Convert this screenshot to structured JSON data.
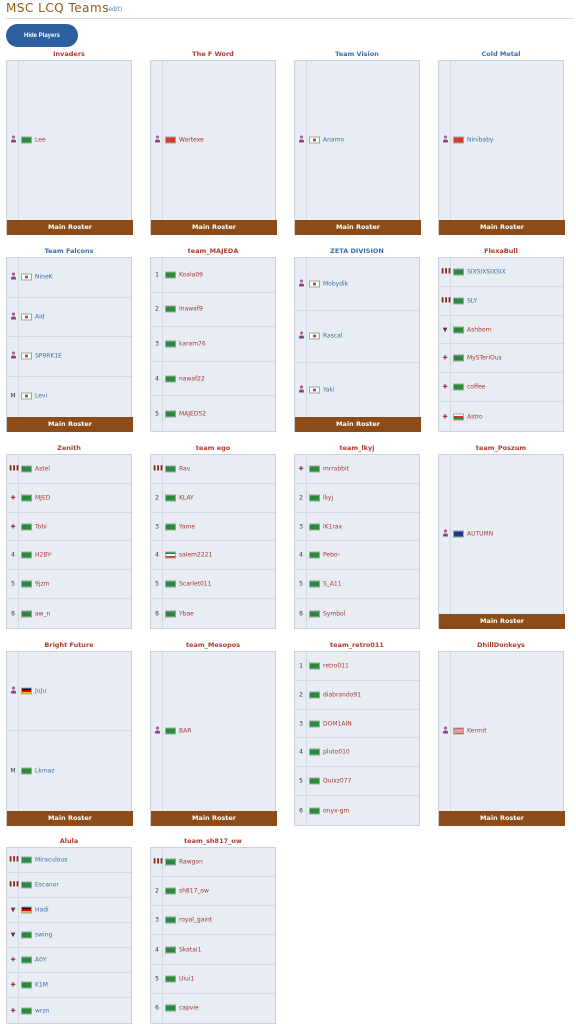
{
  "header": {
    "title": "MSC LCQ Teams",
    "edit": "(edit)"
  },
  "hide_button": "Hide Players",
  "roster_label": "Main Roster",
  "teams": [
    {
      "name": "Invaders",
      "color": "red",
      "players": [
        {
          "role": "person",
          "flag": "sa",
          "name": "Lee",
          "color": "red"
        }
      ]
    },
    {
      "name": "The F Word",
      "color": "red",
      "players": [
        {
          "role": "person",
          "flag": "cn",
          "name": "Wartexe",
          "color": "red"
        }
      ]
    },
    {
      "name": "Team Vision",
      "color": "blue",
      "players": [
        {
          "role": "person",
          "flag": "kr",
          "name": "Anamo",
          "color": "blue"
        }
      ]
    },
    {
      "name": "Cold Metal",
      "color": "blue",
      "players": [
        {
          "role": "person",
          "flag": "cn",
          "name": "Ninibaby",
          "color": "blue"
        }
      ]
    },
    {
      "name": "Team Falcons",
      "color": "blue",
      "players": [
        {
          "role": "person",
          "flag": "kr",
          "name": "NineK",
          "color": "blue"
        },
        {
          "role": "person",
          "flag": "kr",
          "name": "Aid",
          "color": "blue"
        },
        {
          "role": "person",
          "flag": "kr",
          "name": "SP9RK1E",
          "color": "blue"
        },
        {
          "role": "M",
          "flag": "kr",
          "name": "Levi",
          "color": "blue"
        }
      ]
    },
    {
      "name": "team_MAJEDA",
      "color": "red",
      "players": [
        {
          "role": "1",
          "flag": "sa",
          "name": "Koala09",
          "color": "red"
        },
        {
          "role": "2",
          "flag": "sa",
          "name": "Inawaf9",
          "color": "red"
        },
        {
          "role": "3",
          "flag": "sa",
          "name": "karam76",
          "color": "red"
        },
        {
          "role": "4",
          "flag": "sa",
          "name": "nawaf22",
          "color": "red"
        },
        {
          "role": "5",
          "flag": "sa",
          "name": "MAJED52",
          "color": "red"
        }
      ]
    },
    {
      "name": "ZETA DIVISION",
      "color": "blue",
      "players": [
        {
          "role": "person",
          "flag": "kr",
          "name": "Mobydik",
          "color": "blue"
        },
        {
          "role": "person",
          "flag": "kr",
          "name": "Rascal",
          "color": "blue"
        },
        {
          "role": "person",
          "flag": "kr",
          "name": "Yaki",
          "color": "blue"
        }
      ]
    },
    {
      "name": "FlexaBull",
      "color": "red",
      "players": [
        {
          "role": "tank",
          "flag": "sa",
          "name": "SIXSIXSIXSIX",
          "color": "blue"
        },
        {
          "role": "tank",
          "flag": "sa",
          "name": "SLY",
          "color": "blue"
        },
        {
          "role": "shield",
          "flag": "sa",
          "name": "Ashborn",
          "color": "red"
        },
        {
          "role": "plus",
          "flag": "sa",
          "name": "MySTeriOus",
          "color": "red"
        },
        {
          "role": "plus",
          "flag": "sa",
          "name": "coffee",
          "color": "red"
        },
        {
          "role": "plus",
          "flag": "om",
          "name": "Astro",
          "color": "red"
        }
      ]
    },
    {
      "name": "Zenith",
      "color": "red",
      "players": [
        {
          "role": "tank",
          "flag": "sa",
          "name": "Astel",
          "color": "red"
        },
        {
          "role": "plus",
          "flag": "sa",
          "name": "MJED",
          "color": "red"
        },
        {
          "role": "plus",
          "flag": "sa",
          "name": "Tobi",
          "color": "red"
        },
        {
          "role": "4",
          "flag": "sa",
          "name": "H2BY-",
          "color": "red"
        },
        {
          "role": "5",
          "flag": "sa",
          "name": "9jzm",
          "color": "red"
        },
        {
          "role": "6",
          "flag": "sa",
          "name": "aw_n",
          "color": "red"
        }
      ]
    },
    {
      "name": "team ego",
      "color": "red",
      "players": [
        {
          "role": "tank",
          "flag": "sa",
          "name": "Rav",
          "color": "red"
        },
        {
          "role": "2",
          "flag": "sa",
          "name": "KLAY",
          "color": "red"
        },
        {
          "role": "3",
          "flag": "sa",
          "name": "Yame",
          "color": "red"
        },
        {
          "role": "4",
          "flag": "kw",
          "name": "salem2221",
          "color": "red"
        },
        {
          "role": "5",
          "flag": "sa",
          "name": "Scarlet011",
          "color": "red"
        },
        {
          "role": "6",
          "flag": "sa",
          "name": "Ybae",
          "color": "red"
        }
      ]
    },
    {
      "name": "team_lkyj",
      "color": "red",
      "players": [
        {
          "role": "plus",
          "flag": "sa",
          "name": "mrrabbit",
          "color": "red"
        },
        {
          "role": "2",
          "flag": "sa",
          "name": "lkyj",
          "color": "red"
        },
        {
          "role": "3",
          "flag": "sa",
          "name": "lK1rax",
          "color": "red"
        },
        {
          "role": "4",
          "flag": "sa",
          "name": "Pebo-",
          "color": "red"
        },
        {
          "role": "5",
          "flag": "sa",
          "name": "S_A11",
          "color": "red"
        },
        {
          "role": "6",
          "flag": "sa",
          "name": "Symbol",
          "color": "red"
        }
      ]
    },
    {
      "name": "team_Poszum",
      "color": "red",
      "players": [
        {
          "role": "person",
          "flag": "au",
          "name": "AUTUMN",
          "color": "red"
        }
      ]
    },
    {
      "name": "Bright Future",
      "color": "red",
      "players": [
        {
          "role": "person",
          "flag": "de",
          "name": "JuJu",
          "color": "blue"
        },
        {
          "role": "M",
          "flag": "sa",
          "name": "Lkmaz",
          "color": "blue"
        }
      ]
    },
    {
      "name": "team_Mesopos",
      "color": "red",
      "players": [
        {
          "role": "person",
          "flag": "sa",
          "name": "BAR",
          "color": "red"
        }
      ]
    },
    {
      "name": "team_retro011",
      "color": "red",
      "players": [
        {
          "role": "1",
          "flag": "sa",
          "name": "retro011",
          "color": "red"
        },
        {
          "role": "2",
          "flag": "sa",
          "name": "diabrando91",
          "color": "red"
        },
        {
          "role": "3",
          "flag": "sa",
          "name": "DOM1AIN",
          "color": "red"
        },
        {
          "role": "4",
          "flag": "sa",
          "name": "pluto010",
          "color": "red"
        },
        {
          "role": "5",
          "flag": "sa",
          "name": "Quixz077",
          "color": "red"
        },
        {
          "role": "6",
          "flag": "sa",
          "name": "onyx-gm",
          "color": "red"
        }
      ]
    },
    {
      "name": "DhillDonkeys",
      "color": "red",
      "players": [
        {
          "role": "person",
          "flag": "us",
          "name": "Kermit",
          "color": "red"
        }
      ]
    },
    {
      "name": "Alula",
      "color": "red",
      "players": [
        {
          "role": "tank",
          "flag": "sa",
          "name": "Miraculous",
          "color": "blue"
        },
        {
          "role": "tank",
          "flag": "sa",
          "name": "Escanor",
          "color": "blue"
        },
        {
          "role": "shield",
          "flag": "de",
          "name": "Hadi",
          "color": "blue"
        },
        {
          "role": "shield",
          "flag": "sa",
          "name": "swing",
          "color": "blue"
        },
        {
          "role": "plus",
          "flag": "sa",
          "name": "A0Y",
          "color": "blue"
        },
        {
          "role": "plus",
          "flag": "sa",
          "name": "K1M",
          "color": "blue"
        },
        {
          "role": "plus",
          "flag": "sa",
          "name": "wrzn",
          "color": "blue"
        }
      ]
    },
    {
      "name": "team_sh817_ow",
      "color": "red",
      "players": [
        {
          "role": "tank",
          "flag": "sa",
          "name": "Rawgon",
          "color": "red"
        },
        {
          "role": "2",
          "flag": "sa",
          "name": "sh817_ow",
          "color": "red"
        },
        {
          "role": "3",
          "flag": "sa",
          "name": "royal_gaint",
          "color": "red"
        },
        {
          "role": "4",
          "flag": "sa",
          "name": "Skatai1",
          "color": "red"
        },
        {
          "role": "5",
          "flag": "sa",
          "name": "Uiui1",
          "color": "red"
        },
        {
          "role": "6",
          "flag": "sa",
          "name": "capvie",
          "color": "red"
        }
      ]
    }
  ]
}
